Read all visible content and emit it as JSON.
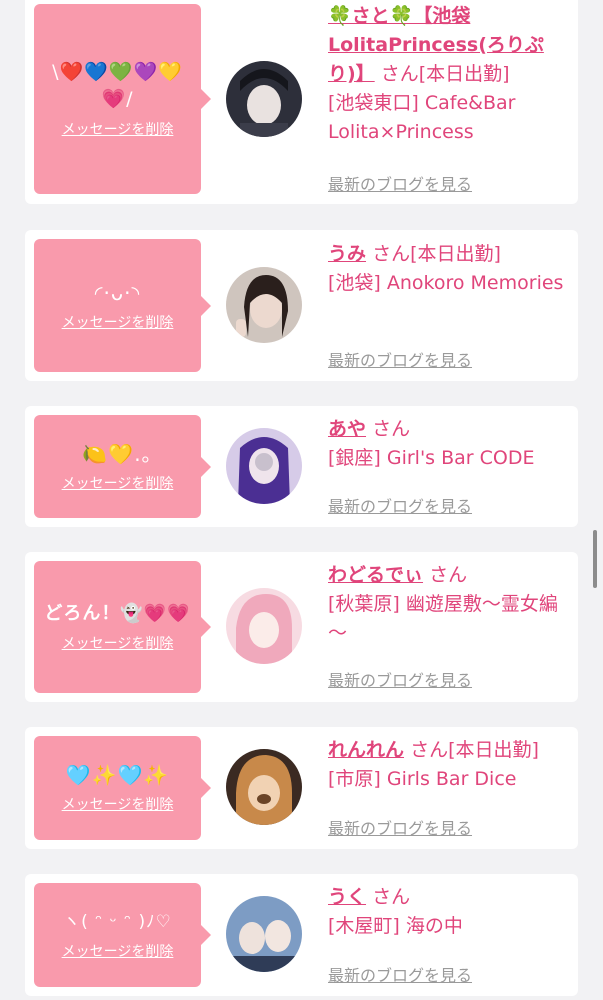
{
  "items": [
    {
      "message": "\\❤️💙💚💜💛💗/",
      "delete_label": "メッセージを削除",
      "name": "🍀さと🍀【池袋LolitaPrincess(ろりぷり)】",
      "suffix": "さん[本日出勤]",
      "shop": "[池袋東口] Cafe&Bar Lolita×Princess",
      "blog_label": "最新のブログを見る",
      "avatar_colors": [
        "#2d2f3a",
        "#e9e2e0"
      ]
    },
    {
      "message": "◜·ᴗ·◝",
      "delete_label": "メッセージを削除",
      "name": "うみ",
      "suffix": "さん[本日出勤]",
      "shop": "[池袋] Anokoro Memories",
      "blog_label": "最新のブログを見る",
      "avatar_colors": [
        "#3a2d2a",
        "#d9c9c0"
      ]
    },
    {
      "message": "🍋💛.｡",
      "delete_label": "メッセージを削除",
      "name": "あや",
      "suffix": "さん",
      "shop": "[銀座] Girl's Bar CODE",
      "blog_label": "最新のブログを見る",
      "avatar_colors": [
        "#5b3ea6",
        "#c7b8e8"
      ]
    },
    {
      "message": "どろん！👻💗💗",
      "delete_label": "メッセージを削除",
      "name": "わどるでぃ",
      "suffix": "さん",
      "shop": "[秋葉原] 幽遊屋敷～霊女編～",
      "blog_label": "最新のブログを見る",
      "avatar_colors": [
        "#f2b9c6",
        "#ffe6ea"
      ]
    },
    {
      "message": "🩵✨🩵✨",
      "delete_label": "メッセージを削除",
      "name": "れんれん",
      "suffix": "さん[本日出勤]",
      "shop": "[市原] Girls Bar Dice",
      "blog_label": "最新のブログを見る",
      "avatar_colors": [
        "#6a4a2f",
        "#e9c6a0"
      ]
    },
    {
      "message": "ヽ( ᵔ ᵕ ᵔ )ﾉ♡",
      "delete_label": "メッセージを削除",
      "name": "うく",
      "suffix": "さん",
      "shop": "[木屋町] 海の中",
      "blog_label": "最新のブログを見る",
      "avatar_colors": [
        "#4a6e9a",
        "#dfe8f3"
      ]
    }
  ]
}
